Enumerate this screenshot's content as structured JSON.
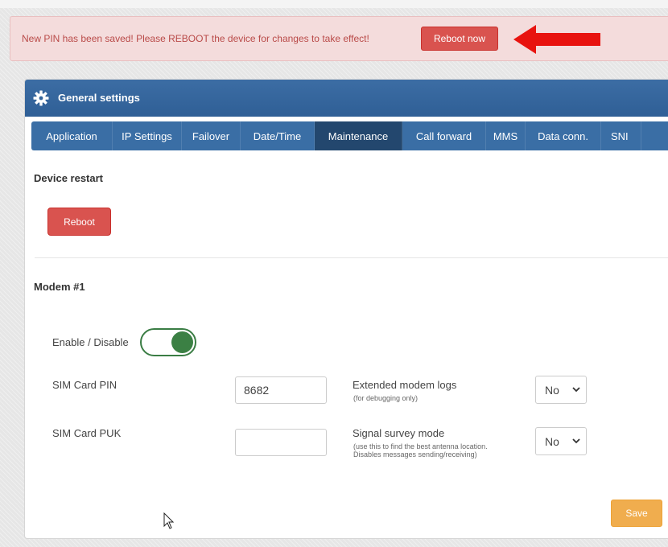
{
  "alert": {
    "message": "New PIN has been saved! Please REBOOT the device for changes to take effect!",
    "button_label": "Reboot now"
  },
  "panel": {
    "title": "General settings",
    "icon": "gear-icon"
  },
  "tabs": [
    {
      "label": "Application",
      "active": false
    },
    {
      "label": "IP Settings",
      "active": false
    },
    {
      "label": "Failover",
      "active": false
    },
    {
      "label": "Date/Time",
      "active": false
    },
    {
      "label": "Maintenance",
      "active": true
    },
    {
      "label": "Call forward",
      "active": false
    },
    {
      "label": "MMS",
      "active": false
    },
    {
      "label": "Data conn.",
      "active": false
    },
    {
      "label": "SNI",
      "active": false
    }
  ],
  "device_restart": {
    "title": "Device restart",
    "button_label": "Reboot"
  },
  "modem": {
    "title": "Modem #1",
    "enable_label": "Enable / Disable",
    "enabled": true,
    "sim_pin_label": "SIM Card PIN",
    "sim_pin_value": "8682",
    "sim_puk_label": "SIM Card PUK",
    "sim_puk_value": "",
    "ext_logs_label": "Extended modem logs",
    "ext_logs_hint": "(for debugging only)",
    "ext_logs_value": "No",
    "survey_label": "Signal survey mode",
    "survey_hint_1": "(use this to find the best antenna location.",
    "survey_hint_2": "Disables messages sending/receiving)",
    "survey_value": "No"
  },
  "footer": {
    "save_label": "Save"
  },
  "colors": {
    "primary": "#3a6ea5",
    "active_tab": "#23476e",
    "danger": "#d9534f",
    "warning": "#f0ad4e",
    "toggle_on": "#3b8044"
  }
}
